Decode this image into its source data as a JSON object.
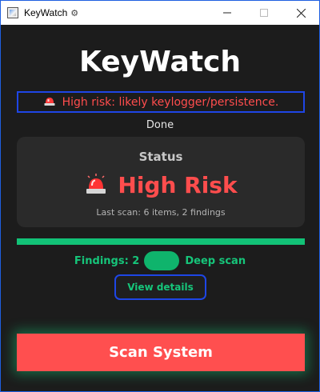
{
  "window": {
    "title": "KeyWatch",
    "title_icon": "gear-icon"
  },
  "app": {
    "title": "KeyWatch"
  },
  "alert": {
    "icon": "siren-icon",
    "text": "High risk: likely keylogger/persistence.",
    "color": "#ff4d4d"
  },
  "status_line": "Done",
  "status_card": {
    "heading": "Status",
    "icon": "siren-icon",
    "value": "High Risk",
    "last_scan": "Last scan: 6 items, 2 findings"
  },
  "progress": {
    "value_percent": 100,
    "color": "#12c277"
  },
  "options": {
    "findings_label": "Findings: 2",
    "deep_scan_label": "Deep scan",
    "deep_scan_on": true
  },
  "buttons": {
    "view_details": "View details",
    "scan_system": "Scan System"
  },
  "colors": {
    "accent_red": "#ff4f4f",
    "accent_green": "#16c57a",
    "focus_blue": "#1e46e6",
    "background": "#1c1c1c"
  }
}
